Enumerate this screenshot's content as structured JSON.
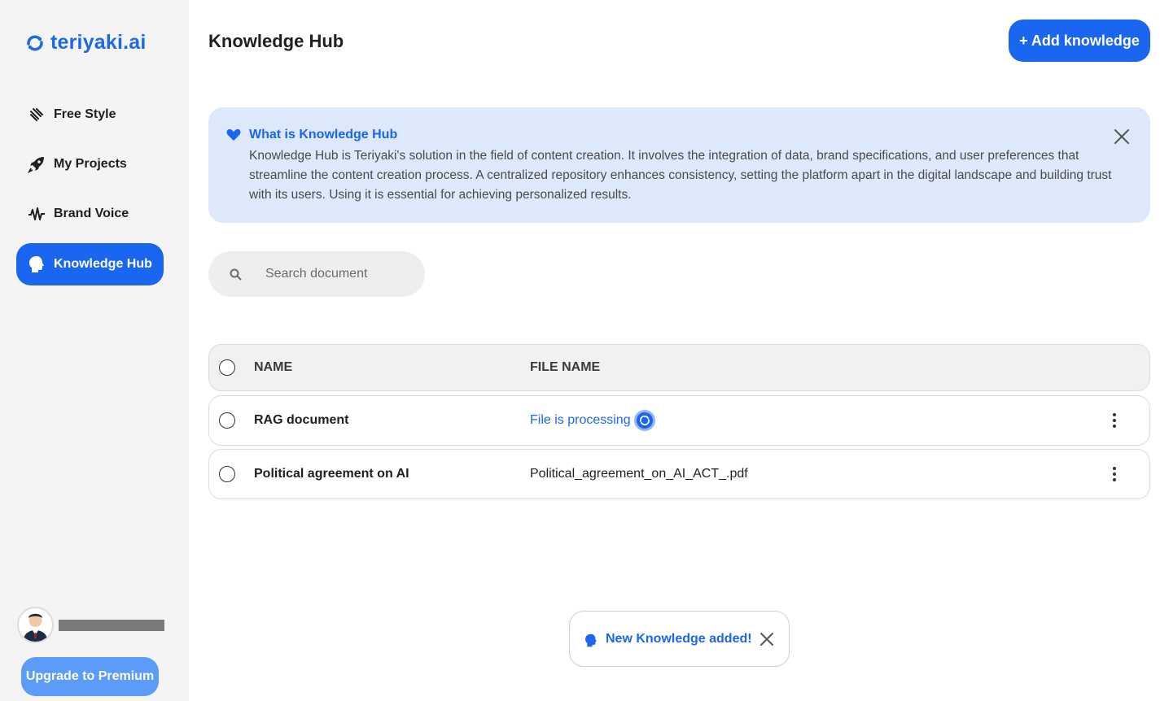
{
  "brand": {
    "name": "teriyaki.ai",
    "logo_icon": "teriyaki-logo-icon",
    "accent": "#1b66f0"
  },
  "sidebar": {
    "items": [
      {
        "label": "Free Style",
        "icon": "freestyle-icon",
        "active": false
      },
      {
        "label": "My Projects",
        "icon": "rocket-icon",
        "active": false
      },
      {
        "label": "Brand Voice",
        "icon": "waveform-icon",
        "active": false
      },
      {
        "label": "Knowledge Hub",
        "icon": "head-icon",
        "active": true
      }
    ],
    "upgrade_label": "Upgrade to Premium"
  },
  "header": {
    "title": "Knowledge Hub",
    "add_label": "+ Add knowledge"
  },
  "info": {
    "title": "What is Knowledge Hub",
    "body": "Knowledge Hub is Teriyaki's solution in the field of content creation. It involves the integration of data, brand specifications, and user preferences that streamline the content creation process. A centralized repository enhances consistency, setting the platform apart in the digital landscape and building trust with its users. Using it is essential for achieving personalized results."
  },
  "search": {
    "placeholder": "Search document"
  },
  "table": {
    "columns": [
      "NAME",
      "FILE NAME"
    ],
    "rows": [
      {
        "name": "RAG document",
        "file": "File is processing",
        "processing": true
      },
      {
        "name": "Political agreement on AI",
        "file": "Political_agreement_on_AI_ACT_.pdf",
        "processing": false
      }
    ]
  },
  "toast": {
    "text": "New Knowledge added!"
  }
}
